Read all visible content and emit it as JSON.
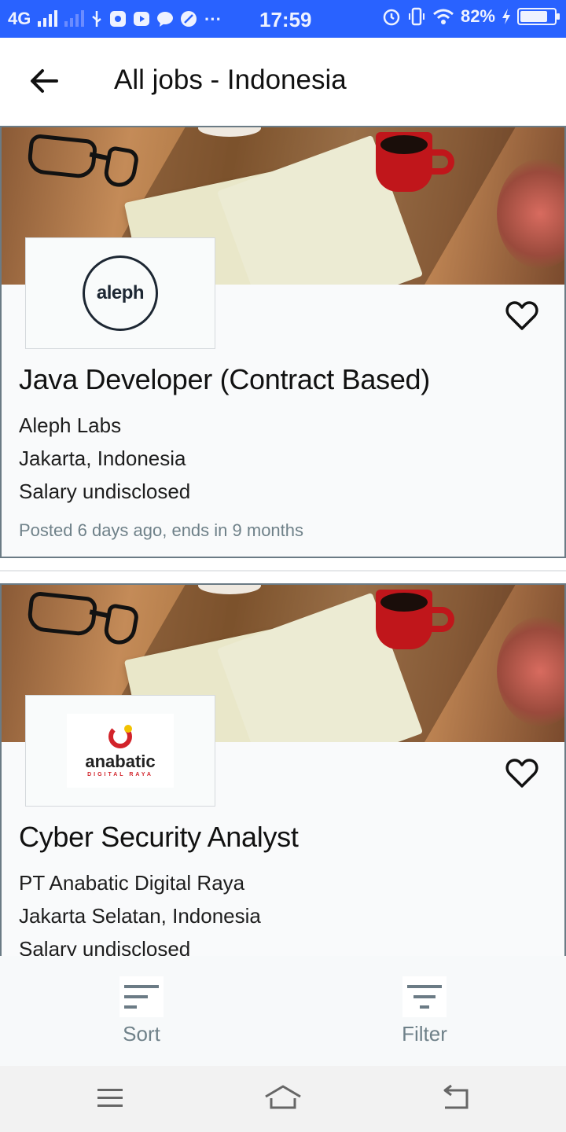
{
  "status_bar": {
    "network": "4G",
    "time": "17:59",
    "battery": "82%",
    "battery_level": 0.82
  },
  "header": {
    "title": "All jobs - Indonesia"
  },
  "jobs": [
    {
      "logo_text": "aleph",
      "title": "Java Developer (Contract Based)",
      "company": "Aleph Labs",
      "location": "Jakarta, Indonesia",
      "salary": "Salary undisclosed",
      "posted": "Posted 6 days ago, ends in 9 months"
    },
    {
      "logo_text": "anabatic",
      "logo_subtext": "DIGITAL RAYA",
      "title": "Cyber Security Analyst",
      "company": "PT Anabatic Digital Raya",
      "location": "Jakarta Selatan, Indonesia",
      "salary": "Salary undisclosed"
    }
  ],
  "actions": {
    "sort_label": "Sort",
    "filter_label": "Filter"
  },
  "colors": {
    "status_bar": "#2962ff",
    "card_border": "#6b7b85",
    "muted_text": "#6f8189",
    "brand_red": "#d2232a"
  },
  "icons": {
    "back": "arrow-left-icon",
    "favorite": "heart-outline-icon",
    "sort": "sort-icon",
    "filter": "filter-icon"
  }
}
